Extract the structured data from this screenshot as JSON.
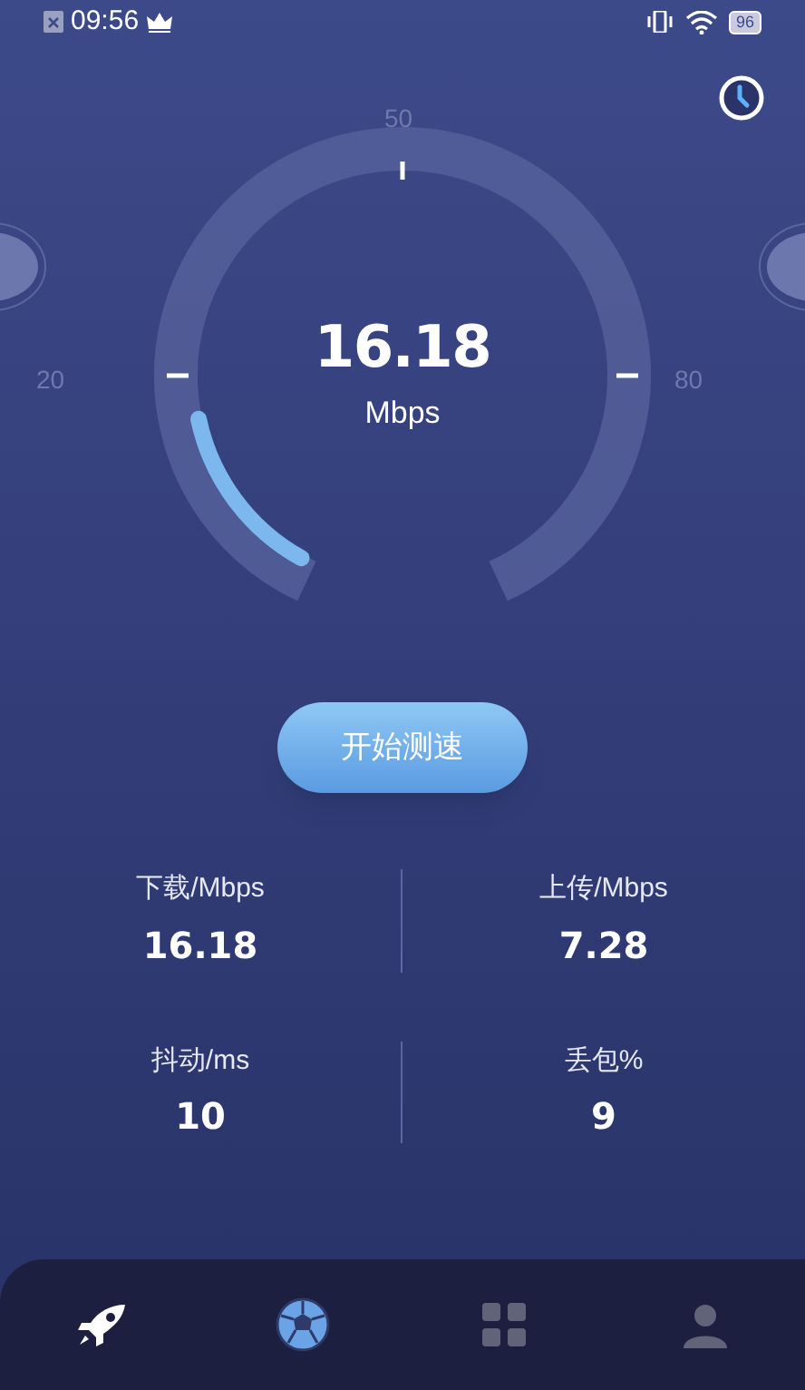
{
  "status_bar": {
    "time": "09:56",
    "battery": "96"
  },
  "gauge": {
    "ticks": [
      {
        "label": "20"
      },
      {
        "label": "50"
      },
      {
        "label": "80"
      }
    ],
    "value": "16.18",
    "unit": "Mbps",
    "level": 0.16
  },
  "start_button": "开始测速",
  "stats": [
    {
      "label": "下载/Mbps",
      "value": "16.18"
    },
    {
      "label": "上传/Mbps",
      "value": "7.28"
    },
    {
      "label": "抖动/ms",
      "value": "10"
    },
    {
      "label": "丢包%",
      "value": "9"
    }
  ],
  "nav": [
    {
      "kind": "rocket",
      "selected": true
    },
    {
      "kind": "globe",
      "selected": true
    },
    {
      "kind": "grid",
      "selected": false
    },
    {
      "kind": "person",
      "selected": false
    }
  ]
}
